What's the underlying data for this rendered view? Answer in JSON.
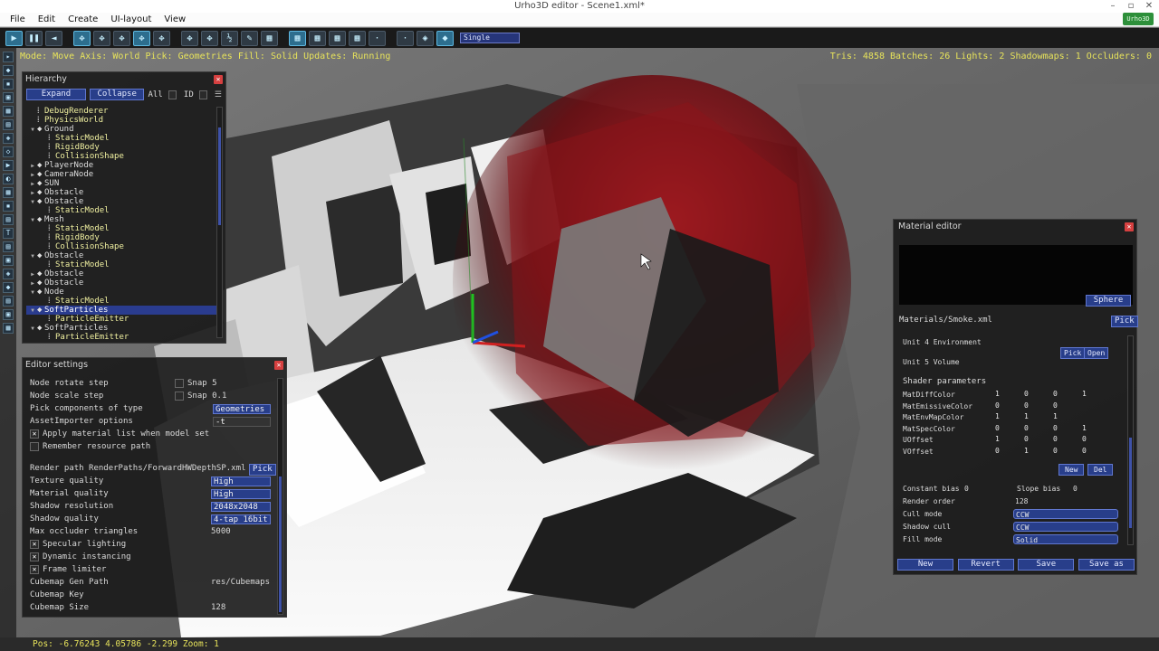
{
  "window": {
    "title": "Urho3D editor - Scene1.xml*",
    "controls": [
      "–",
      "▫",
      "✕"
    ],
    "badge": "Urho3D"
  },
  "menu": [
    "File",
    "Edit",
    "Create",
    "UI-layout",
    "View"
  ],
  "toolbar": {
    "buttons": [
      "▶",
      "❚❚",
      "◄",
      "✥",
      "✥",
      "✥",
      "✥",
      "✥",
      "✥",
      "✥",
      "½",
      "✎",
      "▦",
      "▦",
      "▦",
      "▦",
      "▦",
      "·",
      "◈",
      "◆"
    ],
    "view_mode": "Single"
  },
  "viewport": {
    "status": "Mode: Move  Axis: World  Pick: Geometries  Fill: Solid  Updates: Running",
    "stats": "Tris: 4858  Batches: 26  Lights: 2  Shadowmaps: 1  Occluders: 0"
  },
  "sidebar_icons": [
    "▸",
    "◆",
    "▪",
    "▣",
    "▦",
    "▤",
    "◈",
    "◇",
    "▶",
    "◐",
    "▦",
    "▪",
    "▤",
    "T",
    "▤",
    "▣",
    "◈",
    "◆",
    "▤",
    "▣",
    "▦",
    "▦",
    "◐",
    "▣",
    "▢"
  ],
  "hierarchy": {
    "title": "Hierarchy",
    "expand": "Expand",
    "collapse": "Collapse",
    "all": "All",
    "id": "ID",
    "rows": [
      {
        "label": "DebugRenderer",
        "indent": 1,
        "type": "comp",
        "tw": "",
        "sel": false
      },
      {
        "label": "PhysicsWorld",
        "indent": 1,
        "type": "comp",
        "tw": "",
        "sel": false
      },
      {
        "label": "Ground",
        "indent": 1,
        "type": "node",
        "tw": "▼",
        "sel": false
      },
      {
        "label": "StaticModel",
        "indent": 2,
        "type": "comp",
        "tw": "",
        "sel": false
      },
      {
        "label": "RigidBody",
        "indent": 2,
        "type": "comp",
        "tw": "",
        "sel": false
      },
      {
        "label": "CollisionShape",
        "indent": 2,
        "type": "comp",
        "tw": "",
        "sel": false
      },
      {
        "label": "PlayerNode",
        "indent": 1,
        "type": "node",
        "tw": "▶",
        "sel": false
      },
      {
        "label": "CameraNode",
        "indent": 1,
        "type": "node",
        "tw": "▶",
        "sel": false
      },
      {
        "label": "SUN",
        "indent": 1,
        "type": "node",
        "tw": "▶",
        "sel": false
      },
      {
        "label": "Obstacle",
        "indent": 1,
        "type": "node",
        "tw": "▶",
        "sel": false
      },
      {
        "label": "Obstacle",
        "indent": 1,
        "type": "node",
        "tw": "▼",
        "sel": false
      },
      {
        "label": "StaticModel",
        "indent": 2,
        "type": "comp",
        "tw": "",
        "sel": false
      },
      {
        "label": "Mesh",
        "indent": 1,
        "type": "node",
        "tw": "▼",
        "sel": false
      },
      {
        "label": "StaticModel",
        "indent": 2,
        "type": "comp",
        "tw": "",
        "sel": false
      },
      {
        "label": "RigidBody",
        "indent": 2,
        "type": "comp",
        "tw": "",
        "sel": false
      },
      {
        "label": "CollisionShape",
        "indent": 2,
        "type": "comp",
        "tw": "",
        "sel": false
      },
      {
        "label": "Obstacle",
        "indent": 1,
        "type": "node",
        "tw": "▼",
        "sel": false
      },
      {
        "label": "StaticModel",
        "indent": 2,
        "type": "comp",
        "tw": "",
        "sel": false
      },
      {
        "label": "Obstacle",
        "indent": 1,
        "type": "node",
        "tw": "▶",
        "sel": false
      },
      {
        "label": "Obstacle",
        "indent": 1,
        "type": "node",
        "tw": "▶",
        "sel": false
      },
      {
        "label": "Node",
        "indent": 1,
        "type": "node",
        "tw": "▼",
        "sel": false
      },
      {
        "label": "StaticModel",
        "indent": 2,
        "type": "comp",
        "tw": "",
        "sel": false
      },
      {
        "label": "SoftParticles",
        "indent": 1,
        "type": "node",
        "tw": "▼",
        "sel": true
      },
      {
        "label": "ParticleEmitter",
        "indent": 2,
        "type": "comp",
        "tw": "",
        "sel": false
      },
      {
        "label": "SoftParticles",
        "indent": 1,
        "type": "node",
        "tw": "▼",
        "sel": false
      },
      {
        "label": "ParticleEmitter",
        "indent": 2,
        "type": "comp",
        "tw": "",
        "sel": false
      }
    ]
  },
  "settings": {
    "title": "Editor settings",
    "node_rotate_step": "Node rotate step",
    "snap_rotate": "Snap",
    "snap_rotate_val": "5",
    "node_scale_step": "Node scale step",
    "snap_scale": "Snap",
    "snap_scale_val": "0.1",
    "pick_type_label": "Pick components of type",
    "pick_type_val": "Geometries",
    "asset_importer": "AssetImporter options",
    "asset_importer_val": "-t",
    "apply_material": "Apply material list when model set",
    "remember_path": "Remember resource path",
    "render_path_label": "Render path",
    "render_path_val": "RenderPaths/ForwardHWDepthSP.xml",
    "pick": "Pick",
    "texture_quality": "Texture quality",
    "texture_quality_val": "High",
    "material_quality": "Material quality",
    "material_quality_val": "High",
    "shadow_resolution": "Shadow resolution",
    "shadow_resolution_val": "2048x2048",
    "shadow_quality": "Shadow quality",
    "shadow_quality_val": "4-tap 16bit",
    "max_occluder": "Max occluder triangles",
    "max_occluder_val": "5000",
    "specular": "Specular lighting",
    "instancing": "Dynamic instancing",
    "frame_limiter": "Frame limiter",
    "cubemap_gen_path": "Cubemap Gen Path",
    "cubemap_gen_path_val": "res/Cubemaps",
    "cubemap_key": "Cubemap Key",
    "cubemap_size": "Cubemap Size",
    "cubemap_size_val": "128",
    "check": "✕"
  },
  "material": {
    "title": "Material editor",
    "sphere": "Sphere",
    "file": "Materials/Smoke.xml",
    "pick": "Pick",
    "unit4": "Unit 4 Environment",
    "unit5": "Unit 5 Volume",
    "open": "Open",
    "shader_params": "Shader parameters",
    "params": [
      {
        "name": "MatDiffColor",
        "v": [
          "1",
          "0",
          "0",
          "1"
        ]
      },
      {
        "name": "MatEmissiveColor",
        "v": [
          "0",
          "0",
          "0",
          ""
        ]
      },
      {
        "name": "MatEnvMapColor",
        "v": [
          "1",
          "1",
          "1",
          ""
        ]
      },
      {
        "name": "MatSpecColor",
        "v": [
          "0",
          "0",
          "0",
          "1"
        ]
      },
      {
        "name": "UOffset",
        "v": [
          "1",
          "0",
          "0",
          "0"
        ]
      },
      {
        "name": "VOffset",
        "v": [
          "0",
          "1",
          "0",
          "0"
        ]
      }
    ],
    "new": "New",
    "del": "Del",
    "constant_bias": "Constant bias",
    "constant_bias_val": "0",
    "slope_bias": "Slope bias",
    "slope_bias_val": "0",
    "render_order": "Render order",
    "render_order_val": "128",
    "cull_mode": "Cull mode",
    "cull_mode_val": "CCW",
    "shadow_cull": "Shadow cull",
    "shadow_cull_val": "CCW",
    "fill_mode": "Fill mode",
    "fill_mode_val": "Solid",
    "footer": {
      "new": "New",
      "revert": "Revert",
      "save": "Save",
      "save_as": "Save as"
    }
  },
  "bottom": {
    "status": "Pos: -6.76243 4.05786 -2.299  Zoom: 1"
  },
  "colors": {
    "status_yellow": "#e7e35b",
    "panel_bg": "#181818",
    "accent_blue": "#283e8a",
    "close_red": "#d64040",
    "selection": "#2a3c8f"
  }
}
